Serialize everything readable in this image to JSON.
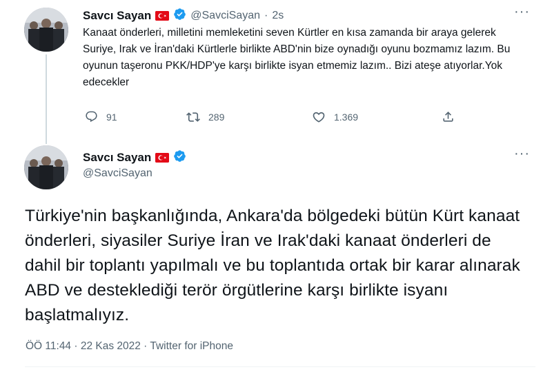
{
  "tweet1": {
    "name": "Savcı Sayan",
    "handle": "@SavciSayan",
    "separator": "·",
    "time": "2s",
    "text": "Kanaat  önderleri, milletini memleketini seven Kürtler en kısa zamanda bir araya gelerek Suriye, Irak ve  İran'daki Kürtlerle birlikte ABD'nin bize oynadığı oyunu bozmamız lazım. Bu oyunun taşeronu PKK/HDP'ye karşı birlikte isyan etmemiz lazım.. Bizi ateşe atıyorlar.Yok edecekler",
    "replies": "91",
    "retweets": "289",
    "likes": "1.369",
    "more": "···"
  },
  "tweet2": {
    "name": "Savcı Sayan",
    "handle": "@SavciSayan",
    "more": "···",
    "text": "Türkiye'nin başkanlığında, Ankara'da bölgedeki bütün Kürt kanaat önderleri, siyasiler Suriye İran ve Irak'daki kanaat önderleri de dahil bir toplantı yapılmalı ve bu toplantıda ortak bir karar alınarak ABD ve desteklediği terör örgütlerine karşı birlikte isyanı başlatmalıyız.",
    "timestamp": "ÖÖ 11:44 · 22 Kas 2022 · Twitter for iPhone"
  },
  "icons": {
    "flag": "turkey-flag-icon",
    "verified": "verified-badge-icon",
    "reply": "reply-icon",
    "retweet": "retweet-icon",
    "like": "heart-icon",
    "share": "share-icon"
  },
  "colors": {
    "text": "#0f1419",
    "secondary": "#536471",
    "verified": "#1d9bf0",
    "flag": "#e30a17",
    "thread_line": "#cfd9de"
  }
}
